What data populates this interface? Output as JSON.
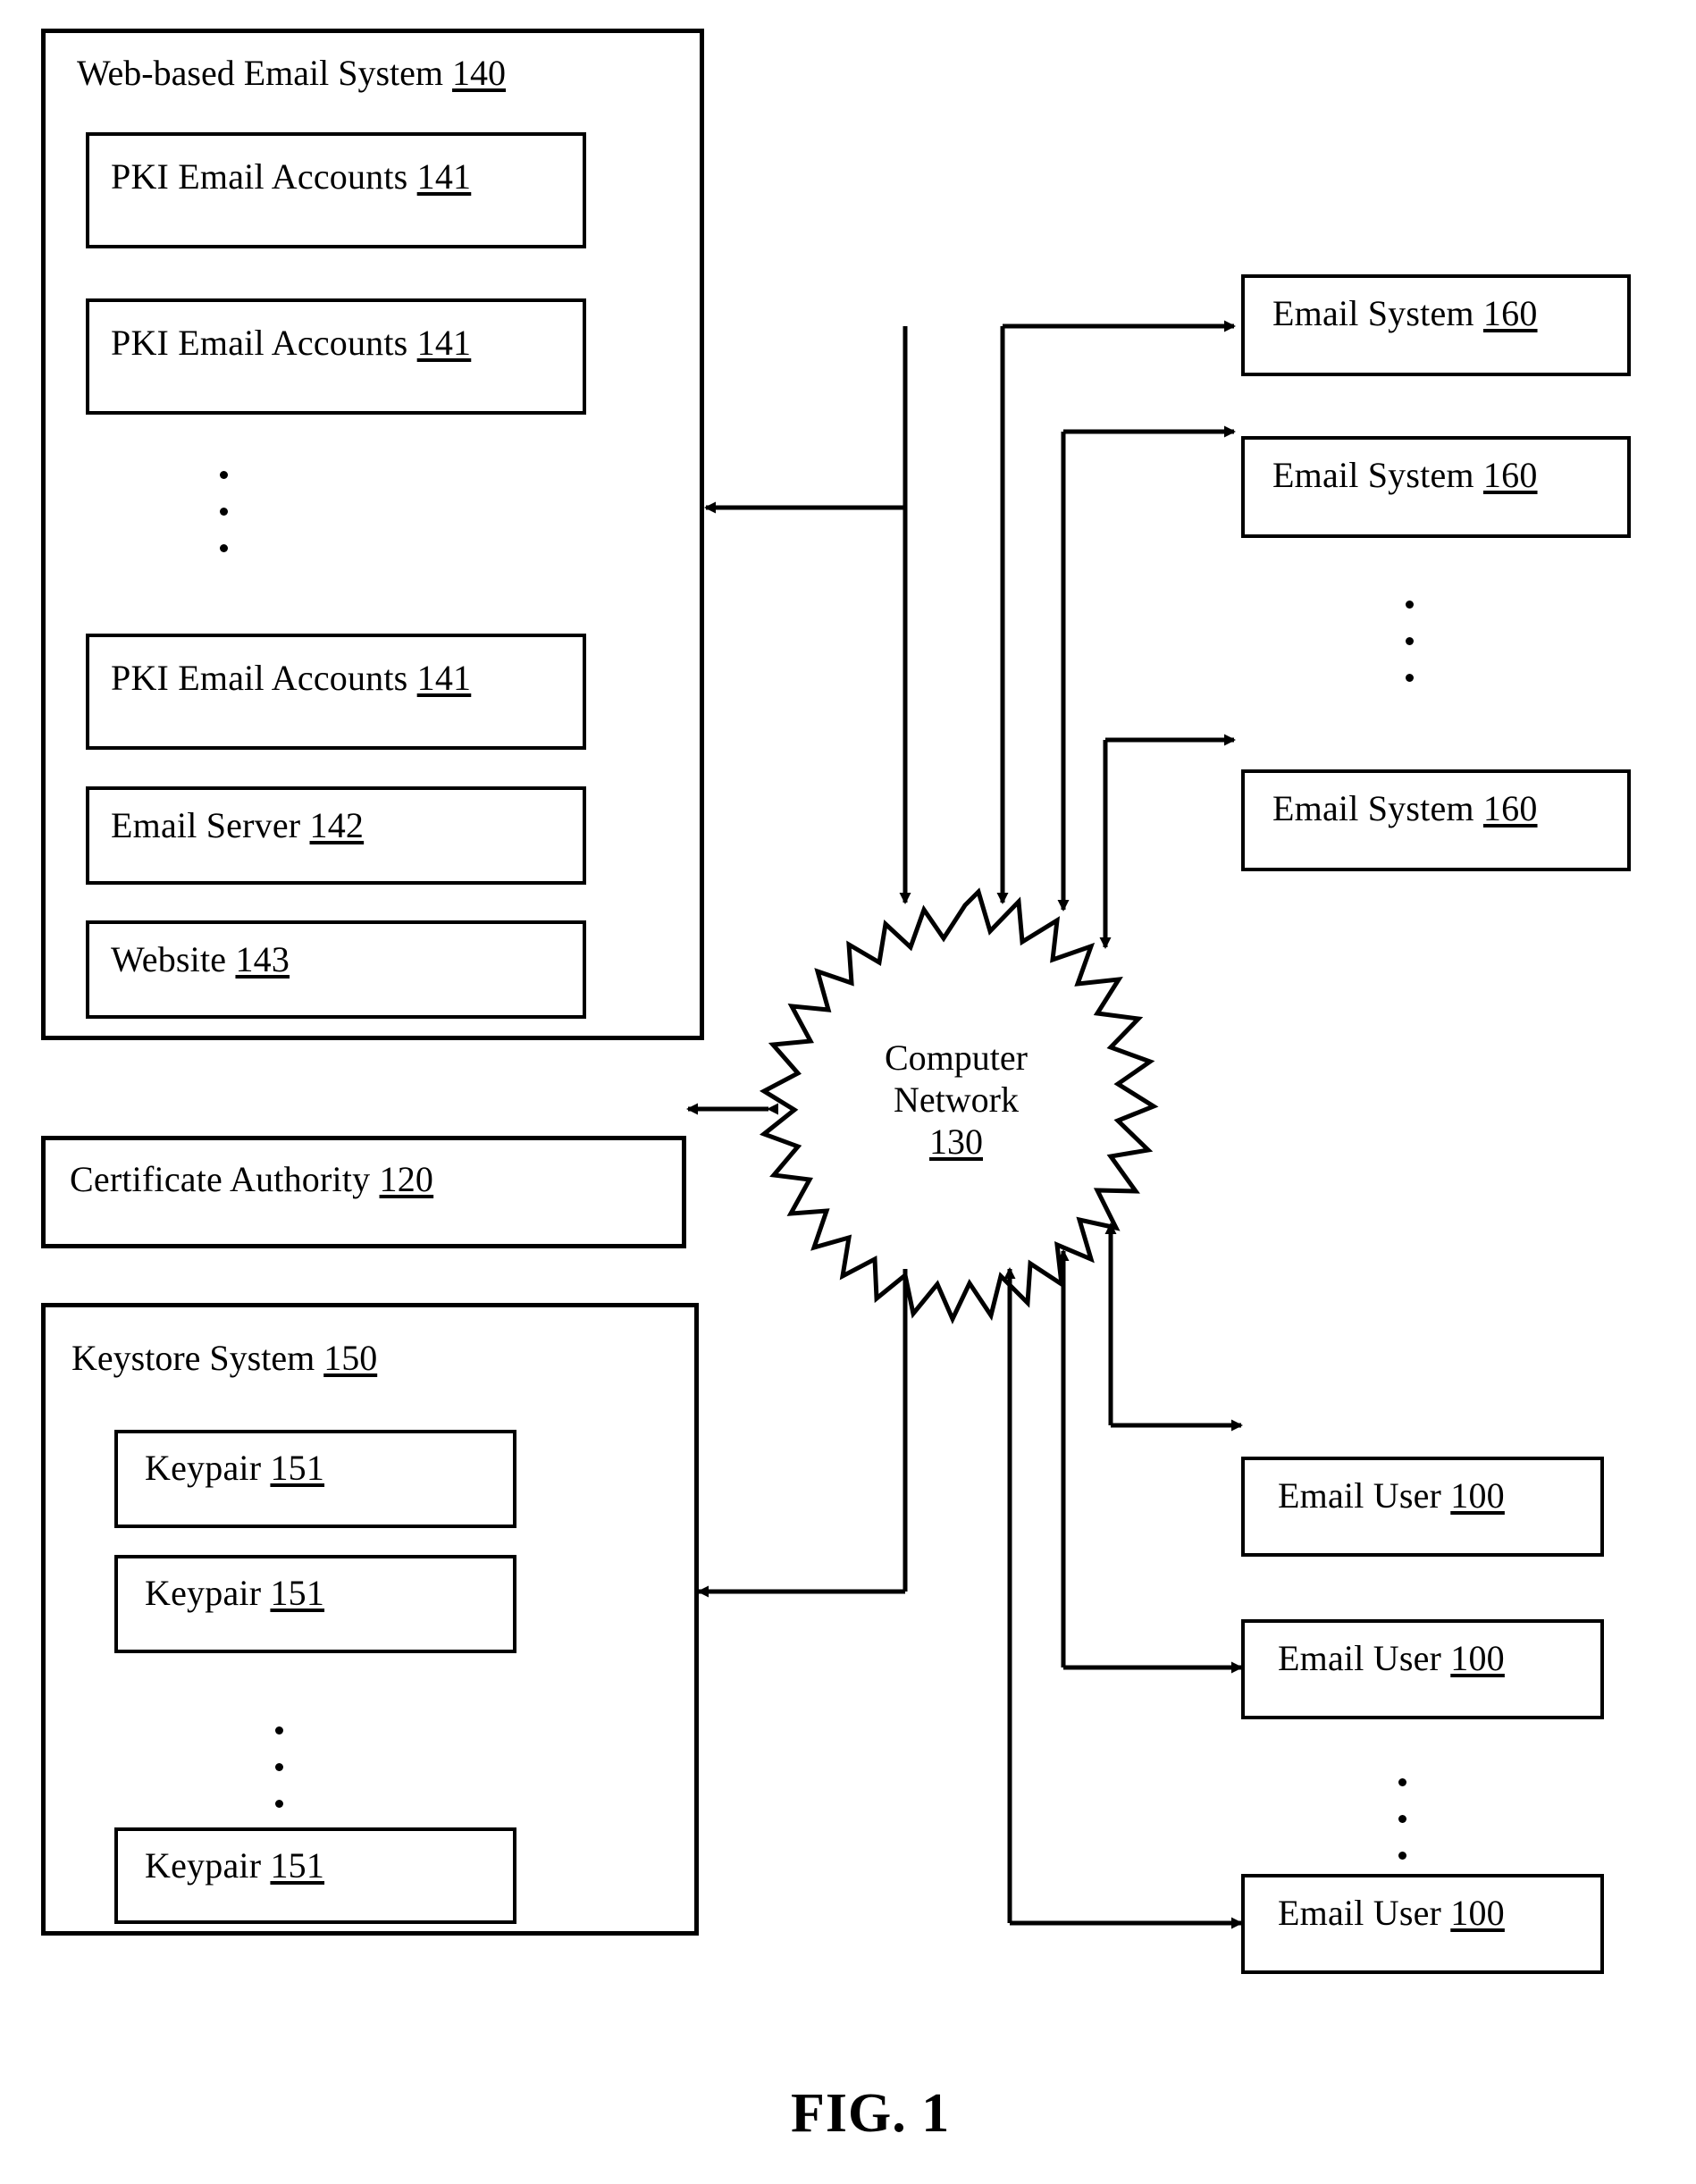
{
  "figure": {
    "caption": "FIG. 1"
  },
  "web_email_system": {
    "title_text": "Web-based Email System ",
    "title_ref": "140",
    "children": [
      {
        "text": "PKI Email Accounts ",
        "ref": "141"
      },
      {
        "text": "PKI Email Accounts ",
        "ref": "141"
      },
      {
        "text": "PKI Email Accounts ",
        "ref": "141"
      },
      {
        "text": "Email Server ",
        "ref": "142"
      },
      {
        "text": "Website ",
        "ref": "143"
      }
    ],
    "ellipsis": "vertical-three-dots"
  },
  "certificate_authority": {
    "text": "Certificate Authority ",
    "ref": "120"
  },
  "keystore_system": {
    "title_text": "Keystore System ",
    "title_ref": "150",
    "children": [
      {
        "text": "Keypair ",
        "ref": "151"
      },
      {
        "text": "Keypair ",
        "ref": "151"
      },
      {
        "text": "Keypair ",
        "ref": "151"
      }
    ],
    "ellipsis": "vertical-three-dots"
  },
  "computer_network": {
    "line1": "Computer",
    "line2": "Network",
    "ref": "130"
  },
  "email_systems": [
    {
      "text": "Email System ",
      "ref": "160"
    },
    {
      "text": "Email System ",
      "ref": "160"
    },
    {
      "text": "Email System ",
      "ref": "160"
    }
  ],
  "email_users": [
    {
      "text": "Email User ",
      "ref": "100"
    },
    {
      "text": "Email User ",
      "ref": "100"
    },
    {
      "text": "Email User ",
      "ref": "100"
    }
  ],
  "colors": {
    "stroke": "#000000",
    "background": "#ffffff"
  }
}
